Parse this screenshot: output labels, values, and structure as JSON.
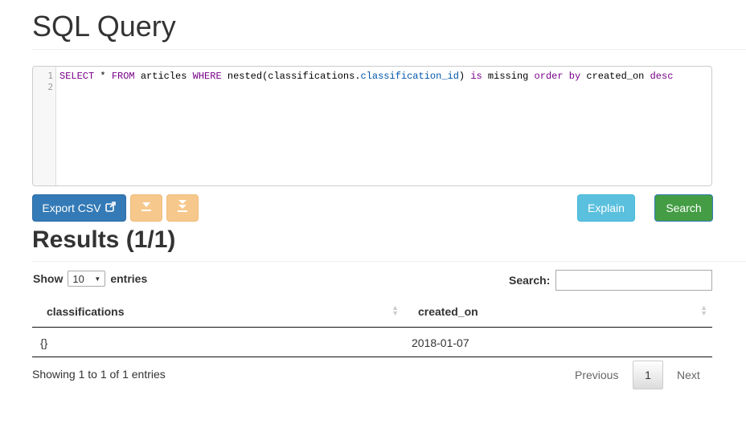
{
  "page": {
    "title": "SQL Query"
  },
  "editor": {
    "line_numbers": [
      "1",
      "2"
    ],
    "tokens": [
      {
        "t": "SELECT",
        "c": "kw"
      },
      {
        "t": " * ",
        "c": "plain"
      },
      {
        "t": "FROM",
        "c": "kw"
      },
      {
        "t": " articles ",
        "c": "plain"
      },
      {
        "t": "WHERE",
        "c": "kw"
      },
      {
        "t": " nested(classifications.",
        "c": "plain"
      },
      {
        "t": "classification_id",
        "c": "prop"
      },
      {
        "t": ") ",
        "c": "plain"
      },
      {
        "t": "is",
        "c": "kw"
      },
      {
        "t": " missing ",
        "c": "plain"
      },
      {
        "t": "order",
        "c": "kw"
      },
      {
        "t": " ",
        "c": "plain"
      },
      {
        "t": "by",
        "c": "kw"
      },
      {
        "t": " created_on ",
        "c": "plain"
      },
      {
        "t": "desc",
        "c": "kw"
      }
    ]
  },
  "toolbar": {
    "export_label": "Export CSV",
    "export_icon": "external-link-icon",
    "download_icon": "download-icon",
    "download_all_icon": "download-all-icon",
    "explain_label": "Explain",
    "search_label": "Search"
  },
  "results": {
    "title": "Results (1/1)",
    "length": {
      "prefix": "Show",
      "value": "10",
      "suffix": "entries"
    },
    "filter_label": "Search:",
    "filter_value": "",
    "columns": [
      "classifications",
      "created_on"
    ],
    "rows": [
      [
        "{}",
        "2018-01-07"
      ]
    ],
    "info": "Showing 1 to 1 of 1 entries",
    "pagination": {
      "previous": "Previous",
      "current": "1",
      "next": "Next"
    }
  },
  "colors": {
    "primary": "#337ab7",
    "warning": "#f6c88c",
    "info": "#5bc0de",
    "success": "#449d44"
  }
}
